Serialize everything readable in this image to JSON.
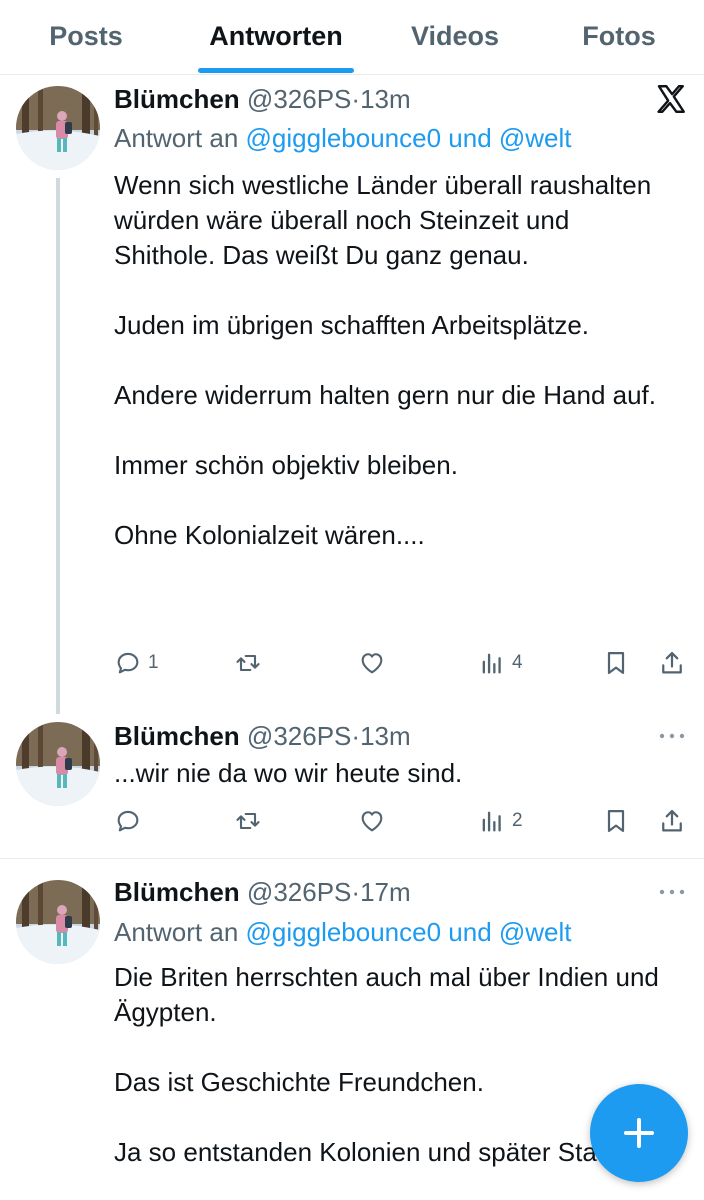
{
  "tabs": [
    {
      "label": "Posts",
      "active": false
    },
    {
      "label": "Antworten",
      "active": true
    },
    {
      "label": "Videos",
      "active": false
    },
    {
      "label": "Fotos",
      "active": false
    }
  ],
  "colors": {
    "accent": "#1d9bf0",
    "text": "#0f1419",
    "secondary": "#536471",
    "border": "#e7e9ea"
  },
  "posts": [
    {
      "name": "Blümchen",
      "handle": "@326PS",
      "time": "13m",
      "reply_prefix": "Antwort an ",
      "reply_user1": "@gigglebounce0",
      "reply_joiner": " und ",
      "reply_user2": "@welt",
      "paragraphs": [
        "Wenn sich westliche Länder überall raushalten würden wäre überall noch Steinzeit und Shithole. Das weißt Du ganz genau.",
        "Juden im übrigen schafften Arbeitsplätze.",
        "Andere widerrum halten gern nur die Hand auf.",
        "Immer schön objektiv bleiben.",
        "Ohne Kolonialzeit wären...."
      ],
      "replies_count": "1",
      "views_count": "4",
      "corner_icon": "x-logo-icon"
    },
    {
      "name": "Blümchen",
      "handle": "@326PS",
      "time": "13m",
      "paragraphs": [
        "...wir nie da wo wir heute sind."
      ],
      "views_count": "2",
      "corner_icon": "more-icon"
    },
    {
      "name": "Blümchen",
      "handle": "@326PS",
      "time": "17m",
      "reply_prefix": "Antwort an ",
      "reply_user1": "@gigglebounce0",
      "reply_joiner": " und ",
      "reply_user2": "@welt",
      "paragraphs": [
        "Die Briten herrschten auch mal über Indien und Ägypten.",
        "Das ist Geschichte Freundchen.",
        "Ja so entstanden Kolonien und später Staaten"
      ],
      "corner_icon": "more-icon"
    }
  ],
  "icons": {
    "reply": "reply-icon",
    "repost": "repost-icon",
    "like": "like-icon",
    "views": "views-icon",
    "bookmark": "bookmark-icon",
    "share": "share-icon",
    "compose": "compose-plus-icon"
  }
}
